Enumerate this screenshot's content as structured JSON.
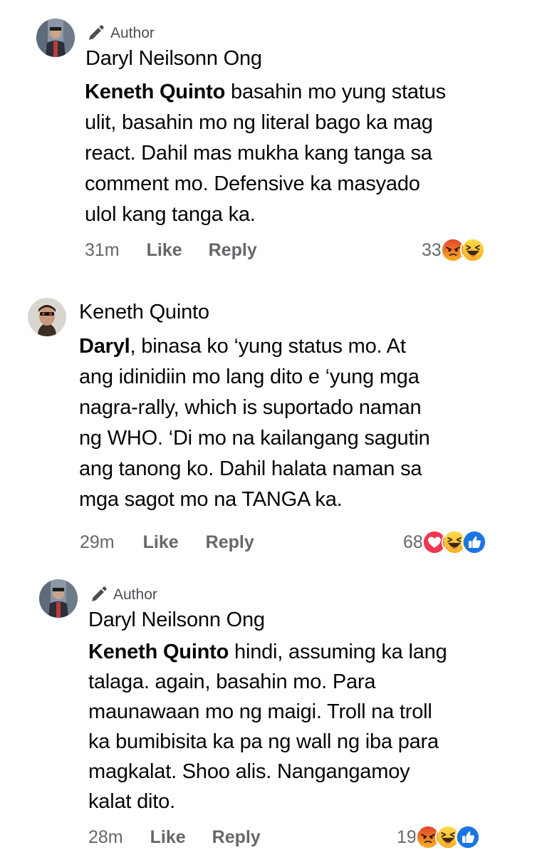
{
  "comments": [
    {
      "author_badge": "Author",
      "name": "Daryl Neilsonn Ong",
      "mention": "Keneth Quinto",
      "text_lines": [
        " basahin mo yung status",
        "ulit, basahin mo ng literal bago ka mag",
        "react. Dahil mas mukha kang tanga sa",
        "comment mo. Defensive ka masyado",
        "ulol kang tanga ka."
      ],
      "time": "31m",
      "like_label": "Like",
      "reply_label": "Reply",
      "reaction_count": "33",
      "reactions": [
        "angry-icon",
        "haha-icon"
      ]
    },
    {
      "name": "Keneth Quinto",
      "mention": "Daryl",
      "text_lines": [
        ", binasa ko ‘yung status mo. At",
        "ang idinidiin mo lang dito e ‘yung mga",
        "nagra-rally, which is suportado naman",
        "ng WHO. ‘Di mo na kailangang sagutin",
        "ang tanong ko. Dahil halata naman sa",
        "mga sagot mo na TANGA ka."
      ],
      "time": "29m",
      "like_label": "Like",
      "reply_label": "Reply",
      "reaction_count": "68",
      "reactions": [
        "love-icon",
        "haha-icon",
        "like-icon"
      ]
    },
    {
      "author_badge": "Author",
      "name": "Daryl Neilsonn Ong",
      "mention": "Keneth Quinto",
      "text_lines": [
        " hindi, assuming ka lang",
        "talaga. again, basahin mo. Para",
        "maunawaan mo ng maigi. Troll na troll",
        "ka bumibisita ka pa ng wall ng iba para",
        "magkalat. Shoo alis. Nangangamoy",
        "kalat dito."
      ],
      "time": "28m",
      "like_label": "Like",
      "reply_label": "Reply",
      "reaction_count": "19",
      "reactions": [
        "angry-icon",
        "haha-icon",
        "like-icon"
      ]
    }
  ]
}
